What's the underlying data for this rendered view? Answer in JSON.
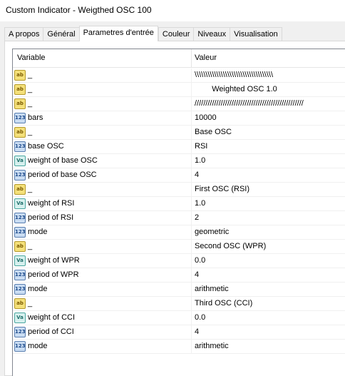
{
  "window": {
    "title": "Custom Indicator - Weigthed OSC 100"
  },
  "tabs": [
    {
      "label": "A propos"
    },
    {
      "label": "Général"
    },
    {
      "label": "Parametres d'entrée",
      "active": true
    },
    {
      "label": "Couleur"
    },
    {
      "label": "Niveaux"
    },
    {
      "label": "Visualisation"
    }
  ],
  "table": {
    "headers": {
      "variable": "Variable",
      "value": "Valeur"
    },
    "rows": [
      {
        "type": "ab",
        "icon": "string-type-icon",
        "name": "_",
        "value": "\\\\\\\\\\\\\\\\\\\\\\\\\\\\\\\\\\\\\\\\\\\\\\\\\\\\\\\\\\\\\\\\\\\\\\\\",
        "centered": false
      },
      {
        "type": "ab",
        "icon": "string-type-icon",
        "name": "_",
        "value": "Weighted OSC 1.0",
        "centered": true
      },
      {
        "type": "ab",
        "icon": "string-type-icon",
        "name": "_",
        "value": "//////////////////////////////////////////////////",
        "centered": false
      },
      {
        "type": "123",
        "icon": "integer-type-icon",
        "name": "bars",
        "value": "10000"
      },
      {
        "type": "ab",
        "icon": "string-type-icon",
        "name": "_",
        "value": "Base OSC"
      },
      {
        "type": "123",
        "icon": "integer-type-icon",
        "name": "base OSC",
        "value": "RSI"
      },
      {
        "type": "va",
        "icon": "double-type-icon",
        "name": "weight of base OSC",
        "value": "1.0"
      },
      {
        "type": "123",
        "icon": "integer-type-icon",
        "name": "period of base OSC",
        "value": "4"
      },
      {
        "type": "ab",
        "icon": "string-type-icon",
        "name": "_",
        "value": "First OSC (RSI)"
      },
      {
        "type": "va",
        "icon": "double-type-icon",
        "name": "weight of RSI",
        "value": "1.0"
      },
      {
        "type": "123",
        "icon": "integer-type-icon",
        "name": "period of RSI",
        "value": "2"
      },
      {
        "type": "123",
        "icon": "integer-type-icon",
        "name": "mode",
        "value": "geometric"
      },
      {
        "type": "ab",
        "icon": "string-type-icon",
        "name": "_",
        "value": "Second OSC (WPR)"
      },
      {
        "type": "va",
        "icon": "double-type-icon",
        "name": "weight of WPR",
        "value": "0.0"
      },
      {
        "type": "123",
        "icon": "integer-type-icon",
        "name": "period of WPR",
        "value": "4"
      },
      {
        "type": "123",
        "icon": "integer-type-icon",
        "name": "mode",
        "value": "arithmetic"
      },
      {
        "type": "ab",
        "icon": "string-type-icon",
        "name": "_",
        "value": "Third OSC (CCI)"
      },
      {
        "type": "va",
        "icon": "double-type-icon",
        "name": "weight of CCI",
        "value": "0.0"
      },
      {
        "type": "123",
        "icon": "integer-type-icon",
        "name": "period of CCI",
        "value": "4"
      },
      {
        "type": "123",
        "icon": "integer-type-icon",
        "name": "mode",
        "value": "arithmetic"
      }
    ]
  },
  "icon_glyphs": {
    "ab": "ab",
    "123": "123",
    "va": "Va"
  }
}
